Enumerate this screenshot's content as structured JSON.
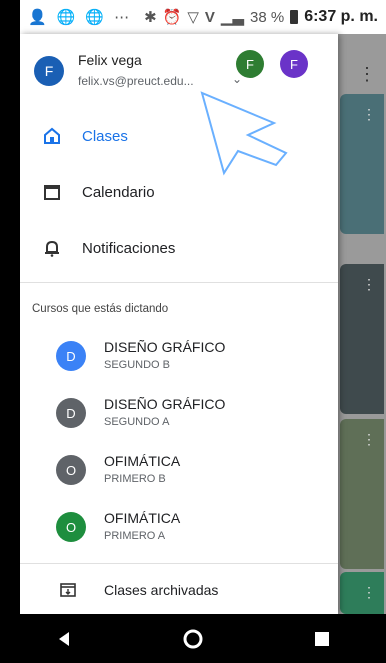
{
  "status_bar": {
    "left_icons": [
      "person-icon",
      "globe-icon",
      "globe-icon",
      "more-dots-icon"
    ],
    "right_icons": [
      "bluetooth-icon",
      "alarm-icon",
      "wifi-icon",
      "volte-icon",
      "signal-icon"
    ],
    "battery": "38 %",
    "time": "6:37 p. m."
  },
  "account": {
    "initial": "F",
    "name": "Felix vega",
    "email": "felix.vs@preuct.edu...",
    "other_accounts": [
      {
        "initial": "F",
        "color": "#2e7d32"
      },
      {
        "initial": "F",
        "color": "#6a33c8"
      }
    ]
  },
  "nav": {
    "items": [
      {
        "label": "Clases",
        "icon": "home-icon",
        "active": true
      },
      {
        "label": "Calendario",
        "icon": "calendar-icon",
        "active": false
      },
      {
        "label": "Notificaciones",
        "icon": "bell-icon",
        "active": false
      }
    ]
  },
  "section": {
    "teaching_label": "Cursos que estás dictando"
  },
  "courses": [
    {
      "initial": "D",
      "title": "DISEÑO GRÁFICO",
      "section": "SEGUNDO B",
      "color": "#3b82f6"
    },
    {
      "initial": "D",
      "title": "DISEÑO GRÁFICO",
      "section": "SEGUNDO A",
      "color": "#5f6368"
    },
    {
      "initial": "O",
      "title": "OFIMÁTICA",
      "section": "PRIMERO B",
      "color": "#5f6368"
    },
    {
      "initial": "O",
      "title": "OFIMÁTICA",
      "section": "PRIMERO A",
      "color": "#1e8e3e"
    }
  ],
  "archived": {
    "label": "Clases archivadas",
    "icon": "archive-icon"
  },
  "background": {
    "menu_icon": "more-vert-icon"
  },
  "system_nav": {
    "back": "back-icon",
    "home": "home-circle-icon",
    "recents": "recents-icon"
  }
}
